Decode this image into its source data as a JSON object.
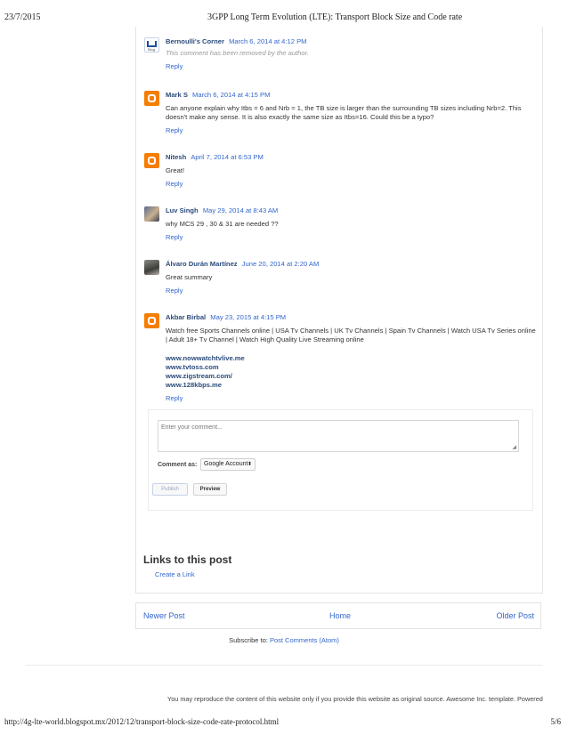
{
  "print_header": {
    "date": "23/7/2015",
    "title": "3GPP Long Term Evolution (LTE): Transport Block Size and Code rate"
  },
  "print_footer": {
    "url": "http://4g-lte-world.blogspot.mx/2012/12/transport-block-size-code-rate-protocol.html",
    "page": "5/6"
  },
  "comments": [
    {
      "author": "Bernoulli's Corner",
      "date": "March 6, 2014 at 4:12 PM",
      "text": "This comment has been removed by the author.",
      "reply": "Reply",
      "avatar": "blog-logo"
    },
    {
      "author": "Mark S",
      "date": "March 6, 2014 at 4:15 PM",
      "text": "Can anyone explain why Itbs = 6 and Nrb = 1, the TB size is larger than the surrounding TB sizes including Nrb=2. This doesn't make any sense. It is also exactly the same size as Itbs=16. Could this be a typo?",
      "reply": "Reply",
      "avatar": "blogger-icon"
    },
    {
      "author": "Nitesh",
      "date": "April 7, 2014 at 6:53 PM",
      "text": "Great!",
      "reply": "Reply",
      "avatar": "blogger-icon"
    },
    {
      "author": "Luv Singh",
      "date": "May 29, 2014 at 8:43 AM",
      "text": "why MCS 29 , 30 & 31 are needed ??",
      "reply": "Reply",
      "avatar": "user-photo"
    },
    {
      "author": "Álvaro Durán Martínez",
      "date": "June 20, 2014 at 2:20 AM",
      "text": "Great summary",
      "reply": "Reply",
      "avatar": "user-photo"
    },
    {
      "author": "Akbar Birbal",
      "date": "May 23, 2015 at 4:15 PM",
      "text": "Watch free Sports Channels online | USA Tv Channels | UK Tv Channels | Spain Tv Channels | Watch USA Tv Series online | Adult 18+ Tv Channel | Watch High Quality Live Streaming online",
      "links": [
        "www.nowwatchtvlive.me",
        "www.tvtoss.com",
        "www.zigstream.com/",
        "www.128kbps.me"
      ],
      "reply": "Reply",
      "avatar": "blogger-icon"
    }
  ],
  "comment_form": {
    "placeholder": "Enter your comment...",
    "comment_as_label": "Comment as:",
    "account_value": "Google Account",
    "publish_label": "Publish",
    "preview_label": "Preview"
  },
  "links_section": {
    "title": "Links to this post",
    "create_link": "Create a Link"
  },
  "pager": {
    "newer": "Newer Post",
    "home": "Home",
    "older": "Older Post"
  },
  "subscribe": {
    "label": "Subscribe to:",
    "link": "Post Comments (Atom)"
  },
  "attribution": "You may reproduce the content of this website only if you provide this website as original source. Awesome Inc. template. Powered",
  "colors": {
    "link": "#3366cc",
    "author": "#2a4b7c",
    "blogger_orange": "#f57d00"
  }
}
